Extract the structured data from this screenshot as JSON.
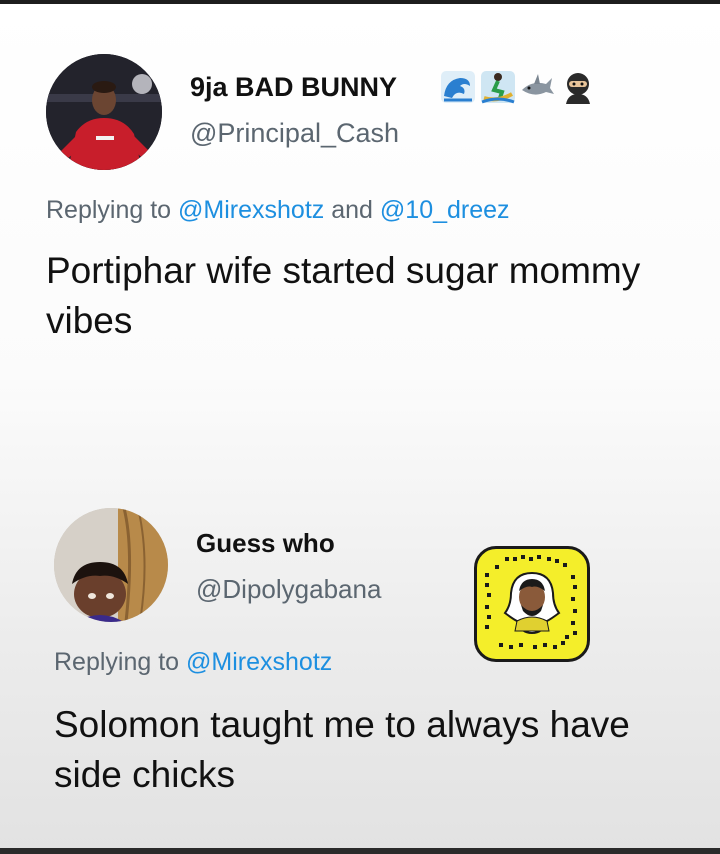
{
  "tweets": [
    {
      "display_name": "9ja BAD BUNNY",
      "name_emojis": [
        "wave-icon",
        "surfer-icon",
        "shark-icon",
        "ninja-icon"
      ],
      "handle": "@Principal_Cash",
      "replying_prefix": "Replying to",
      "replying_to_1": "@Mirexshotz",
      "replying_joiner": "and",
      "replying_to_2": "@10_dreez",
      "text": "Portiphar wife started sugar mommy vibes"
    },
    {
      "display_name": "Guess who",
      "handle": "@Dipolygabana",
      "replying_prefix": "Replying to",
      "replying_to_1": "@Mirexshotz",
      "text": "Solomon taught me to always have side chicks",
      "snapcode": "snapcode-icon"
    }
  ],
  "colors": {
    "mention": "#1d8fe0",
    "secondary_text": "#5b6670",
    "snapcode_yellow": "#f4ee2a"
  }
}
